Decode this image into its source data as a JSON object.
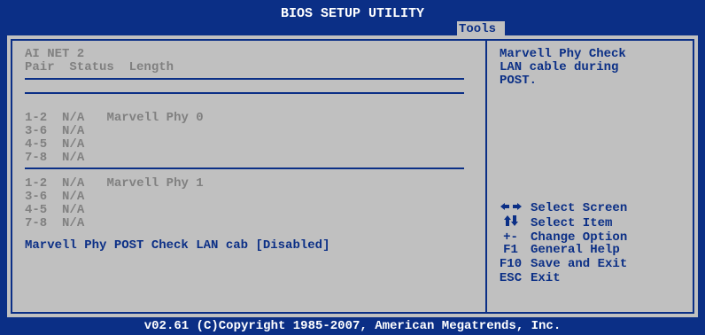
{
  "title": "BIOS SETUP UTILITY",
  "tab": "Tools",
  "left": {
    "section_title": "AI NET 2",
    "columns": "Pair  Status  Length",
    "phy0": {
      "rows": [
        {
          "pair": "1-2",
          "status": "N/A",
          "length": "Marvell Phy 0"
        },
        {
          "pair": "3-6",
          "status": "N/A",
          "length": ""
        },
        {
          "pair": "4-5",
          "status": "N/A",
          "length": ""
        },
        {
          "pair": "7-8",
          "status": "N/A",
          "length": ""
        }
      ]
    },
    "phy1": {
      "rows": [
        {
          "pair": "1-2",
          "status": "N/A",
          "length": "Marvell Phy 1"
        },
        {
          "pair": "3-6",
          "status": "N/A",
          "length": ""
        },
        {
          "pair": "4-5",
          "status": "N/A",
          "length": ""
        },
        {
          "pair": "7-8",
          "status": "N/A",
          "length": ""
        }
      ]
    },
    "option_label": "Marvell Phy POST Check LAN cab",
    "option_value": "[Disabled]"
  },
  "help": {
    "description_lines": [
      "Marvell Phy Check",
      "LAN cable during",
      "POST."
    ],
    "keys": [
      {
        "key_icon": "left-right-arrows-icon",
        "action": "Select Screen"
      },
      {
        "key_icon": "up-down-arrows-icon",
        "action": "Select Item"
      },
      {
        "key": "+-",
        "action": "Change Option"
      },
      {
        "key": "F1",
        "action": "General Help"
      },
      {
        "key": "F10",
        "action": "Save and Exit"
      },
      {
        "key": "ESC",
        "action": "Exit"
      }
    ]
  },
  "footer": "v02.61 (C)Copyright 1985-2007, American Megatrends, Inc.",
  "colors": {
    "background": "#0b2f86",
    "panel": "#c0c0c0",
    "muted_text": "#808080"
  }
}
